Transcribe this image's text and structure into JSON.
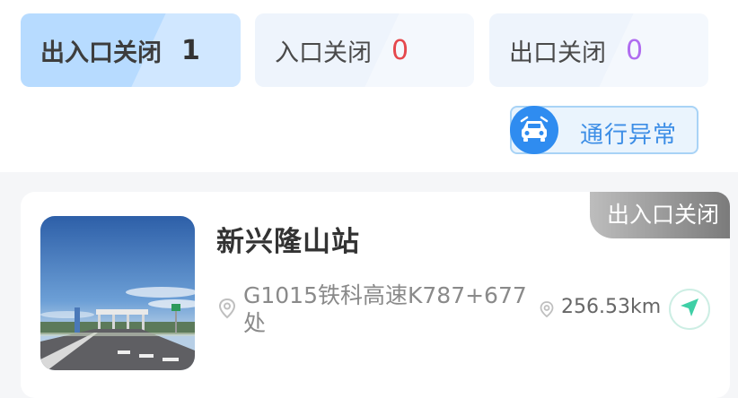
{
  "tabs": [
    {
      "label": "出入口关闭",
      "count": "1"
    },
    {
      "label": "入口关闭",
      "count": "0"
    },
    {
      "label": "出口关闭",
      "count": "0"
    }
  ],
  "abnormal_button": {
    "label": "通行异常",
    "icon": "car-icon"
  },
  "station": {
    "status_ribbon": "出入口关闭",
    "name": "新兴隆山站",
    "address": "G1015铁科高速K787+677处",
    "distance": "256.53km",
    "icons": {
      "address": "location-pin-icon",
      "distance": "location-pin-icon",
      "navigate": "navigation-arrow-icon"
    }
  },
  "colors": {
    "active_tab_bg": "#b7dbff",
    "inactive_tab_bg": "#eef4fc",
    "entry_count": "#e5484d",
    "exit_count": "#b06cf0",
    "accent_blue": "#2f8cf0",
    "nav_green": "#3fcfa6"
  }
}
